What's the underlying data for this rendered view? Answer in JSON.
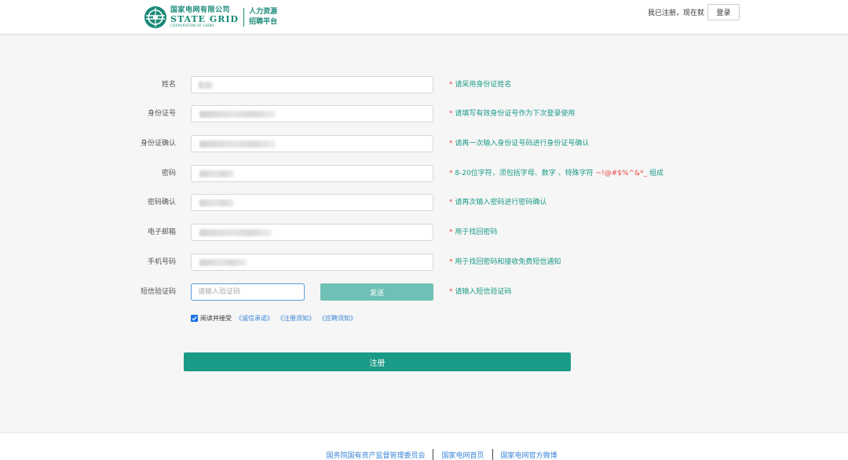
{
  "header": {
    "logo": {
      "company_cn": "国家电网有限公司",
      "company_en": "STATE GRID",
      "company_en_sub": "CORPORATION OF CHINA",
      "sub_line1": "人力资源",
      "sub_line2": "招聘平台"
    },
    "registered_text": "我已注册，现在就",
    "login_label": "登录"
  },
  "form": {
    "fields": [
      {
        "label": "姓名",
        "hint": "请采用身份证姓名"
      },
      {
        "label": "身份证号",
        "hint": "请填写有效身份证号作为下次登录使用"
      },
      {
        "label": "身份证确认",
        "hint": "请再一次输入身份证号码进行身份证号确认"
      },
      {
        "label": "密码",
        "hint": "8-20位字符，须包括字母、数字 、特殊字符",
        "hint_special": "~!@#$%^&*_",
        "hint_suffix": "组成"
      },
      {
        "label": "密码确认",
        "hint": "请再次输入密码进行密码确认"
      },
      {
        "label": "电子邮箱",
        "hint": "用于找回密码"
      },
      {
        "label": "手机号码",
        "hint": "用于找回密码和接收免费短信通知"
      }
    ],
    "sms": {
      "label": "短信验证码",
      "placeholder": "请输入验证码",
      "send_label": "发送",
      "hint": "请输入短信验证码"
    },
    "required_mark": "*",
    "agree": {
      "checked": true,
      "text": "阅读并接受",
      "links": [
        "《诚信承诺》",
        "《注册须知》",
        "《应聘须知》"
      ]
    },
    "register_label": "注册"
  },
  "footer": {
    "links": [
      "国务院国有资产监督管理委员会",
      "国家电网首页",
      "国家电网官方微博"
    ]
  },
  "colors": {
    "brand": "#1a9b87",
    "send_button": "#6ec1b4",
    "required": "#e84343",
    "link": "#3a86d8"
  }
}
